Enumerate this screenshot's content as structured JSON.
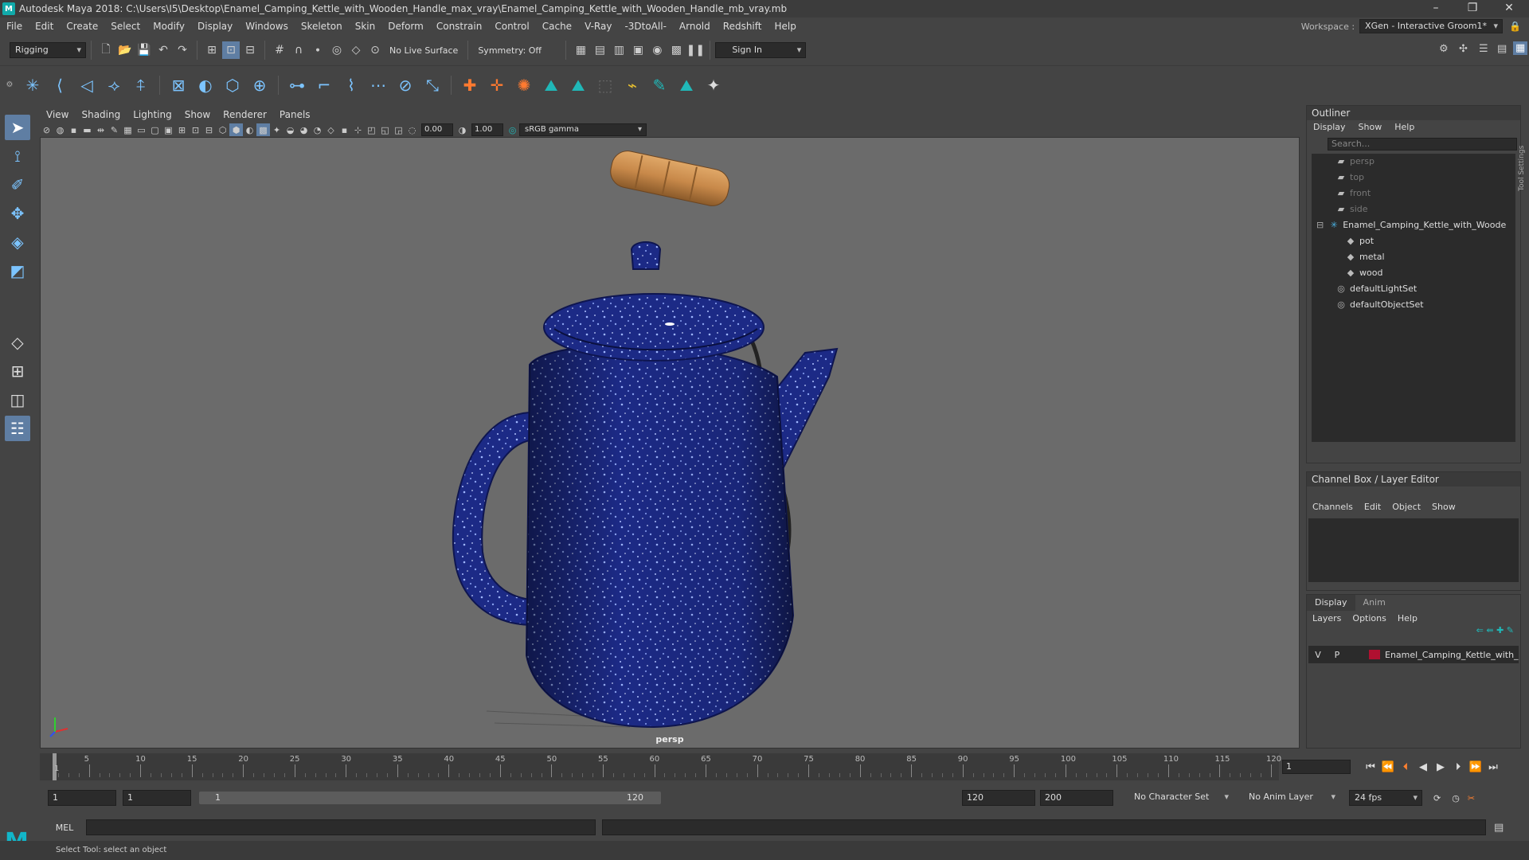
{
  "window": {
    "title": "Autodesk Maya 2018: C:\\Users\\I5\\Desktop\\Enamel_Camping_Kettle_with_Wooden_Handle_max_vray\\Enamel_Camping_Kettle_with_Wooden_Handle_mb_vray.mb",
    "minimize": "–",
    "restore": "❐",
    "close": "✕"
  },
  "menubar": {
    "items": [
      "File",
      "Edit",
      "Create",
      "Select",
      "Modify",
      "Display",
      "Windows",
      "Skeleton",
      "Skin",
      "Deform",
      "Constrain",
      "Control",
      "Cache",
      "V-Ray",
      "-3DtoAll-",
      "Arnold",
      "Redshift",
      "Help"
    ]
  },
  "workspace": {
    "label": "Workspace :",
    "value": "XGen - Interactive Groom1*"
  },
  "statusline": {
    "mode": "Rigging",
    "live_surface": "No Live Surface",
    "symmetry": "Symmetry: Off",
    "sign_in": "Sign In"
  },
  "viewport": {
    "menu": [
      "View",
      "Shading",
      "Lighting",
      "Show",
      "Renderer",
      "Panels"
    ],
    "exposure": "0.00",
    "gamma": "1.00",
    "colorspace": "sRGB gamma",
    "camera_label": "persp"
  },
  "outliner": {
    "title": "Outliner",
    "menu": [
      "Display",
      "Show",
      "Help"
    ],
    "search_placeholder": "Search...",
    "items": [
      {
        "label": "persp",
        "icon": "camera-icon",
        "indent": 1,
        "dim": true
      },
      {
        "label": "top",
        "icon": "camera-icon",
        "indent": 1,
        "dim": true
      },
      {
        "label": "front",
        "icon": "camera-icon",
        "indent": 1,
        "dim": true
      },
      {
        "label": "side",
        "icon": "camera-icon",
        "indent": 1,
        "dim": true
      },
      {
        "label": "Enamel_Camping_Kettle_with_Woode",
        "icon": "group-icon",
        "indent": 0,
        "dim": false
      },
      {
        "label": "pot",
        "icon": "mesh-icon",
        "indent": 2,
        "dim": false
      },
      {
        "label": "metal",
        "icon": "mesh-icon",
        "indent": 2,
        "dim": false
      },
      {
        "label": "wood",
        "icon": "mesh-icon",
        "indent": 2,
        "dim": false
      },
      {
        "label": "defaultLightSet",
        "icon": "set-icon",
        "indent": 1,
        "dim": false
      },
      {
        "label": "defaultObjectSet",
        "icon": "set-icon",
        "indent": 1,
        "dim": false
      }
    ]
  },
  "channelbox": {
    "title": "Channel Box / Layer Editor",
    "menu": [
      "Channels",
      "Edit",
      "Object",
      "Show"
    ]
  },
  "layer_editor": {
    "tabs": [
      "Display",
      "Anim"
    ],
    "menu": [
      "Layers",
      "Options",
      "Help"
    ],
    "layer": {
      "v": "V",
      "p": "P",
      "name": "Enamel_Camping_Kettle_with_",
      "color": "#b01030"
    }
  },
  "timeline": {
    "ticks": [
      "5",
      "10",
      "15",
      "20",
      "25",
      "30",
      "35",
      "40",
      "45",
      "50",
      "55",
      "60",
      "65",
      "70",
      "75",
      "80",
      "85",
      "90",
      "95",
      "100",
      "105",
      "110",
      "115",
      "120"
    ],
    "start_label": "1",
    "current_frame": "1"
  },
  "range": {
    "start": "1",
    "playback_start": "1",
    "range_start": "1",
    "range_end": "120",
    "playback_end": "120",
    "end": "200",
    "character_set": "No Character Set",
    "anim_layer": "No Anim Layer",
    "fps": "24 fps"
  },
  "cmdline": {
    "lang": "MEL"
  },
  "statusbar": {
    "help": "Select Tool: select an object"
  },
  "toolsettings": "Tool Settings",
  "colors": {
    "kettle": "#1a2a8a",
    "wood": "#c8894a",
    "viewport_bg": "#6b6b6b"
  }
}
